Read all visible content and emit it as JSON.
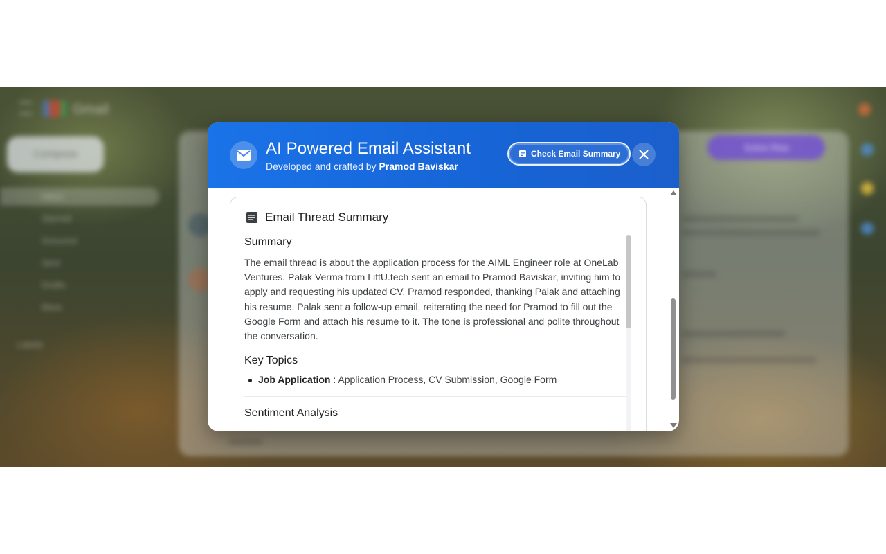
{
  "background": {
    "app_name": "Gmail",
    "compose_label": "Compose",
    "nav_items": [
      "Inbox",
      "Starred",
      "Snoozed",
      "Sent",
      "Drafts",
      "More"
    ],
    "labels_heading": "Labels",
    "solve_button": "Solve Rea"
  },
  "modal": {
    "title": "AI Powered Email Assistant",
    "subtitle_prefix": "Developed and crafted by ",
    "author": "Pramod Baviskar",
    "check_summary_label": "Check Email Summary",
    "close_icon": "close-icon",
    "header_icon": "mail-icon",
    "accent_color": "#1a73e8"
  },
  "summary_card": {
    "title": "Email Thread Summary",
    "title_icon": "document-icon",
    "summary_heading": "Summary",
    "summary_text": "The email thread is about the application process for the AIML Engineer role at OneLab Ventures. Palak Verma from LiftU.tech sent an email to Pramod Baviskar, inviting him to apply and requesting his updated CV. Pramod responded, thanking Palak and attaching his resume. Palak sent a follow-up email, reiterating the need for Pramod to fill out the Google Form and attach his resume to it. The tone is professional and polite throughout the conversation.",
    "key_topics_heading": "Key Topics",
    "key_topics": [
      {
        "name": "Job Application",
        "detail": " : Application Process, CV Submission, Google Form"
      }
    ],
    "sentiment_heading": "Sentiment Analysis"
  }
}
